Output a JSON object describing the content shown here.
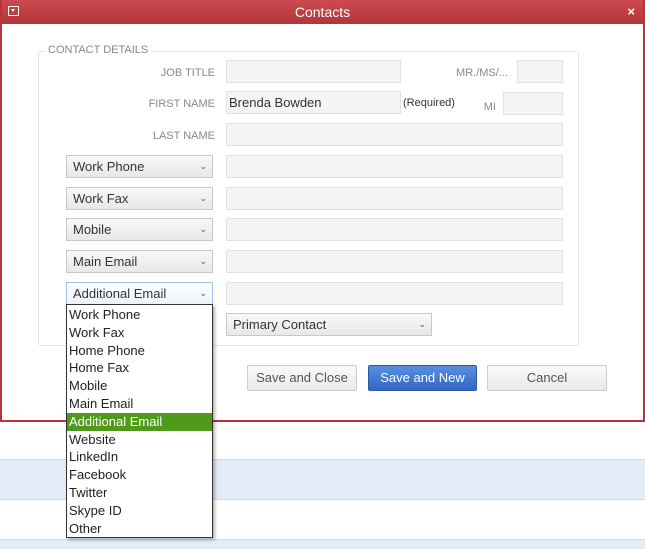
{
  "dialog": {
    "title": "Contacts",
    "menu_icon": "window-menu-icon",
    "close_icon": "close-icon",
    "close_glyph": "×"
  },
  "section": {
    "legend": "CONTACT DETAILS"
  },
  "fields": {
    "job_title": {
      "label": "JOB TITLE",
      "value": ""
    },
    "salutation": {
      "label": "MR./MS/...",
      "value": ""
    },
    "first_name": {
      "label": "FIRST NAME",
      "value": "Brenda Bowden",
      "required_note": "(Required)"
    },
    "mi": {
      "label": "MI",
      "value": ""
    },
    "last_name": {
      "label": "LAST NAME",
      "value": ""
    }
  },
  "contact_rows": [
    {
      "type": "Work Phone",
      "value": ""
    },
    {
      "type": "Work Fax",
      "value": ""
    },
    {
      "type": "Mobile",
      "value": ""
    },
    {
      "type": "Main Email",
      "value": ""
    },
    {
      "type": "Additional Email",
      "value": ""
    }
  ],
  "contact_type_select": {
    "value": "Primary Contact"
  },
  "dropdown": {
    "options": [
      "Work Phone",
      "Work Fax",
      "Home Phone",
      "Home Fax",
      "Mobile",
      "Main Email",
      "Additional Email",
      "Website",
      "LinkedIn",
      "Facebook",
      "Twitter",
      "Skype ID",
      "Other"
    ],
    "selected": "Additional Email",
    "highlight_color": "#4f9a1a"
  },
  "buttons": {
    "save_close": "Save and Close",
    "save_new": "Save and New",
    "cancel": "Cancel"
  },
  "colors": {
    "title_bar": "#b8333a",
    "primary_button": "#3d72d0",
    "row_band": "#e3edf9"
  }
}
